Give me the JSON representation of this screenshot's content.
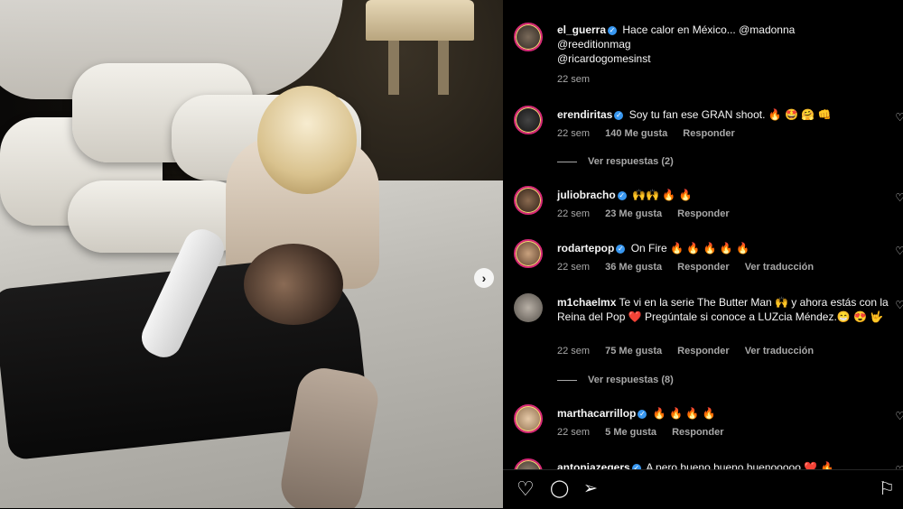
{
  "post": {
    "caption": {
      "user": "el_guerra",
      "line1": "Hace calor en México... @madonna",
      "line2": "@reeditionmag",
      "line3": "@ricardogomesinst",
      "time": "22 sem"
    }
  },
  "comments": [
    {
      "user": "erendiritas",
      "text": "Soy tu fan ese GRAN shoot. 🔥 🤩 🤗 👊",
      "time": "22 sem",
      "likes": "140 Me gusta",
      "reply": "Responder",
      "view_replies": "Ver respuestas (2)"
    },
    {
      "user": "juliobracho",
      "text": "🙌🙌 🔥 🔥",
      "time": "22 sem",
      "likes": "23 Me gusta",
      "reply": "Responder"
    },
    {
      "user": "rodartepop",
      "text": "On Fire 🔥 🔥 🔥 🔥 🔥",
      "time": "22 sem",
      "likes": "36 Me gusta",
      "reply": "Responder",
      "translate": "Ver traducción"
    },
    {
      "user": "m1chaelmx",
      "text": "Te vi en la serie The Butter Man 🙌 y ahora estás con la Reina del Pop ❤️ Pregúntale si conoce a LUZcia Méndez.😁 😍 🤟",
      "time": "22 sem",
      "likes": "75 Me gusta",
      "reply": "Responder",
      "translate": "Ver traducción",
      "view_replies": "Ver respuestas (8)"
    },
    {
      "user": "marthacarrillop",
      "text": "🔥 🔥 🔥 🔥",
      "time": "22 sem",
      "likes": "5 Me gusta",
      "reply": "Responder"
    },
    {
      "user": "antoniazegers",
      "text": "A pero bueno bueno buenooooo ❤️ 🔥"
    }
  ],
  "icons": {
    "heart": "♡",
    "comment": "◯",
    "share": "➢",
    "bookmark": "⚐",
    "next": "›",
    "verified": "✓"
  }
}
